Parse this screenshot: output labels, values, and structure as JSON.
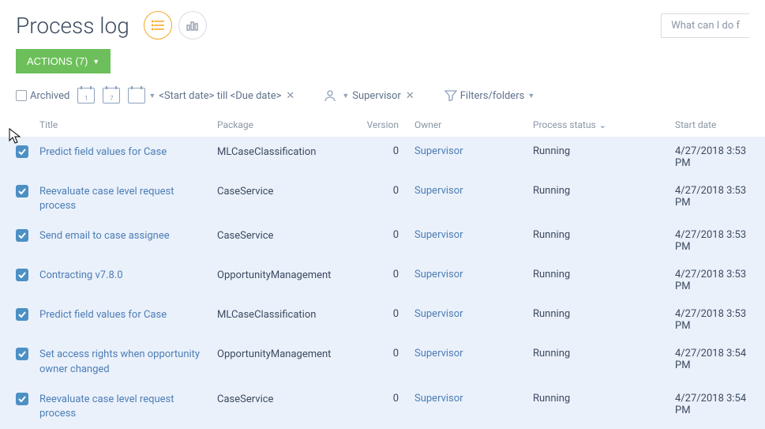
{
  "header": {
    "title": "Process log",
    "search_placeholder": "What can I do f"
  },
  "actions": {
    "label": "ACTIONS (7)"
  },
  "filters": {
    "archived_label": "Archived",
    "cal1": "1",
    "cal7": "7",
    "date_range": "<Start date> till <Due date>",
    "owner_filter": "Supervisor",
    "filters_label": "Filters/folders"
  },
  "columns": {
    "title": "Title",
    "package": "Package",
    "version": "Version",
    "owner": "Owner",
    "status": "Process status",
    "start_date": "Start date"
  },
  "rows": [
    {
      "title": "Predict field values for Case",
      "package": "MLCaseClassification",
      "version": "0",
      "owner": "Supervisor",
      "status": "Running",
      "date": "4/27/2018 3:53 PM"
    },
    {
      "title": "Reevaluate case level request process",
      "package": "CaseService",
      "version": "0",
      "owner": "Supervisor",
      "status": "Running",
      "date": "4/27/2018 3:53 PM"
    },
    {
      "title": "Send email to case assignee",
      "package": "CaseService",
      "version": "0",
      "owner": "Supervisor",
      "status": "Running",
      "date": "4/27/2018 3:53 PM"
    },
    {
      "title": "Contracting v7.8.0",
      "package": "OpportunityManagement",
      "version": "0",
      "owner": "Supervisor",
      "status": "Running",
      "date": "4/27/2018 3:53 PM"
    },
    {
      "title": "Predict field values for Case",
      "package": "MLCaseClassification",
      "version": "0",
      "owner": "Supervisor",
      "status": "Running",
      "date": "4/27/2018 3:53 PM"
    },
    {
      "title": "Set access rights when opportunity owner changed",
      "package": "OpportunityManagement",
      "version": "0",
      "owner": "Supervisor",
      "status": "Running",
      "date": "4/27/2018 3:54 PM"
    },
    {
      "title": "Reevaluate case level request process",
      "package": "CaseService",
      "version": "0",
      "owner": "Supervisor",
      "status": "Running",
      "date": "4/27/2018 3:54 PM"
    }
  ]
}
